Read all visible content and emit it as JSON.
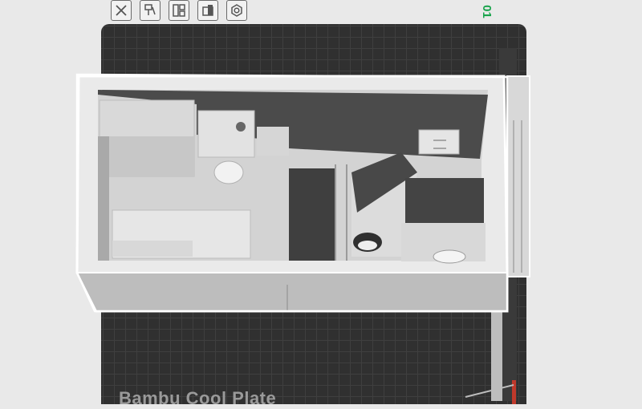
{
  "toolbar": {
    "tools": [
      {
        "icon": "close-icon"
      },
      {
        "icon": "paint-icon"
      },
      {
        "icon": "layout-icon"
      },
      {
        "icon": "support-icon"
      },
      {
        "icon": "settings-icon"
      }
    ]
  },
  "plate": {
    "label": "Bambu Cool Plate",
    "number": "01",
    "number_color": "#17a34a",
    "surface_color": "#303030"
  }
}
